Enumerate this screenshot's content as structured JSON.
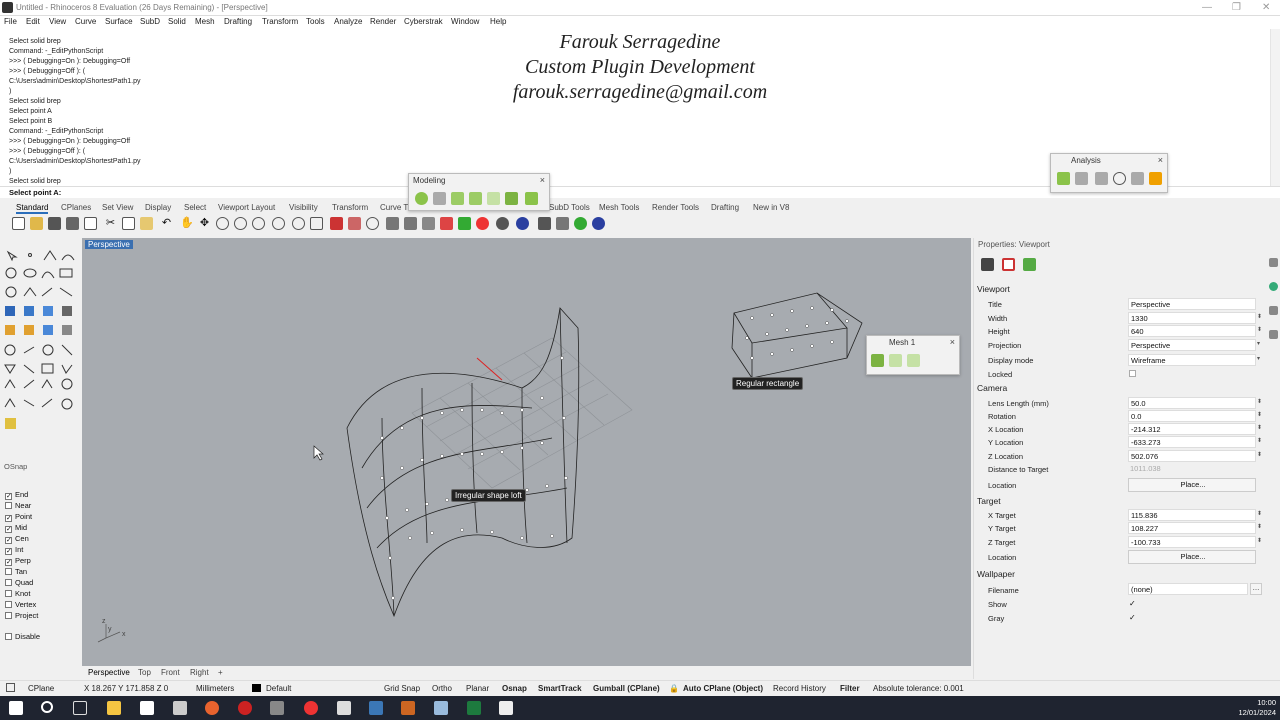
{
  "window": {
    "title": "Untitled - Rhinoceros 8 Evaluation (26 Days Remaining) - [Perspective]",
    "controls": [
      "—",
      "❐",
      "✕"
    ]
  },
  "menu": [
    "File",
    "Edit",
    "View",
    "Curve",
    "Surface",
    "SubD",
    "Solid",
    "Mesh",
    "Drafting",
    "Transform",
    "Tools",
    "Analyze",
    "Render",
    "Cyberstrak",
    "Window",
    "Help"
  ],
  "command_history": [
    "Select solid brep",
    "Command: -_EditPythonScript",
    ">>> ( Debugging=On ): Debugging=Off",
    ">>> ( Debugging=Off ): (",
    "C:\\Users\\admin\\Desktop\\ShortestPath1.py",
    ")",
    "Select solid brep",
    "Select point A",
    "Select point B",
    "Command: -_EditPythonScript",
    ">>> ( Debugging=On ): Debugging=Off",
    ">>> ( Debugging=Off ): (",
    "C:\\Users\\admin\\Desktop\\ShortestPath1.py",
    ")",
    "Select solid brep"
  ],
  "command_prompt": "Select point A:",
  "overlay": {
    "name": "Farouk Serragedine",
    "role": "Custom Plugin Development",
    "email": "farouk.serragedine@gmail.com"
  },
  "toolbar_tabs": [
    "Standard",
    "CPlanes",
    "Set View",
    "Display",
    "Select",
    "Viewport Layout",
    "Visibility",
    "Transform",
    "Curve T",
    "SubD Tools",
    "Mesh Tools",
    "Render Tools",
    "Drafting",
    "New in V8"
  ],
  "floating_panels": {
    "modeling": "Modeling",
    "analysis": "Analysis",
    "mesh": "Mesh 1"
  },
  "viewport": {
    "active_label": "Perspective",
    "labels": {
      "loft": "Irregular shape loft",
      "rect": "Regular rectangle"
    },
    "axes": {
      "x": "x",
      "y": "y",
      "z": "z"
    }
  },
  "viewport_tabs": [
    "Perspective",
    "Top",
    "Front",
    "Right"
  ],
  "osnap": {
    "title": "OSnap",
    "items": [
      {
        "label": "End",
        "checked": true
      },
      {
        "label": "Near",
        "checked": false
      },
      {
        "label": "Point",
        "checked": true
      },
      {
        "label": "Mid",
        "checked": true
      },
      {
        "label": "Cen",
        "checked": true
      },
      {
        "label": "Int",
        "checked": true
      },
      {
        "label": "Perp",
        "checked": true
      },
      {
        "label": "Tan",
        "checked": false
      },
      {
        "label": "Quad",
        "checked": false
      },
      {
        "label": "Knot",
        "checked": false
      },
      {
        "label": "Vertex",
        "checked": false
      },
      {
        "label": "Project",
        "checked": false
      }
    ],
    "disable": "Disable"
  },
  "properties": {
    "panel_title": "Properties: Viewport",
    "viewport_section": "Viewport",
    "title_label": "Title",
    "title_value": "Perspective",
    "width_label": "Width",
    "width_value": "1330",
    "height_label": "Height",
    "height_value": "640",
    "projection_label": "Projection",
    "projection_value": "Perspective",
    "display_label": "Display mode",
    "display_value": "Wireframe",
    "locked_label": "Locked",
    "camera_section": "Camera",
    "lens_label": "Lens Length (mm)",
    "lens_value": "50.0",
    "rotation_label": "Rotation",
    "rotation_value": "0.0",
    "xloc_label": "X Location",
    "xloc_value": "-214.312",
    "yloc_label": "Y Location",
    "yloc_value": "-633.273",
    "zloc_label": "Z Location",
    "zloc_value": "502.076",
    "dist_label": "Distance to Target",
    "dist_value": "1011.038",
    "cam_location_label": "Location",
    "place_button": "Place...",
    "target_section": "Target",
    "xt_label": "X Target",
    "xt_value": "115.836",
    "yt_label": "Y Target",
    "yt_value": "108.227",
    "zt_label": "Z Target",
    "zt_value": "-100.733",
    "tgt_location_label": "Location",
    "wallpaper_section": "Wallpaper",
    "filename_label": "Filename",
    "filename_value": "(none)",
    "show_label": "Show",
    "gray_label": "Gray",
    "check": "✓"
  },
  "statusbar": {
    "cplane": "CPlane",
    "coords": "X 18.267 Y 171.858 Z 0",
    "units": "Millimeters",
    "layer": "Default",
    "grid_snap": "Grid Snap",
    "ortho": "Ortho",
    "planar": "Planar",
    "osnap": "Osnap",
    "smarttrack": "SmartTrack",
    "gumball": "Gumball (CPlane)",
    "autocplane": "Auto CPlane (Object)",
    "record": "Record History",
    "filter": "Filter",
    "tolerance": "Absolute tolerance: 0.001"
  },
  "taskbar": {
    "time": "10:00",
    "date": "12/01/2024"
  }
}
